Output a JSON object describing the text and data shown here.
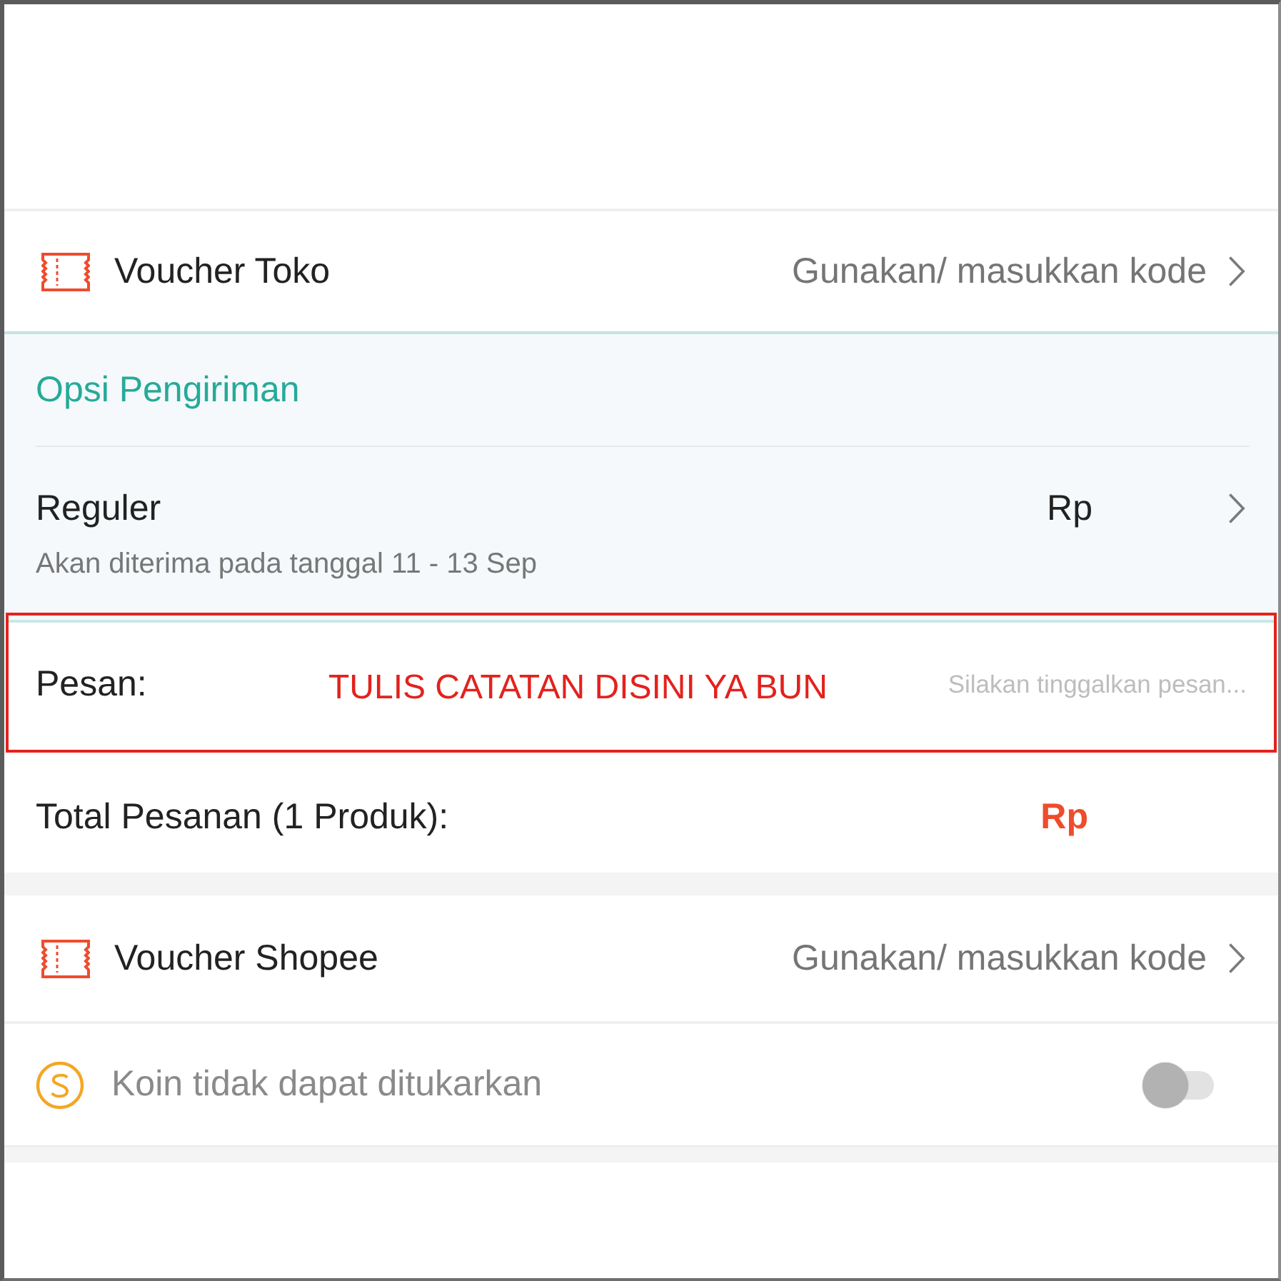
{
  "shop_voucher": {
    "label": "Voucher Toko",
    "action": "Gunakan/ masukkan kode"
  },
  "shipping": {
    "title": "Opsi Pengiriman",
    "option": {
      "name": "Reguler",
      "price": "Rp",
      "estimate": "Akan diterima pada tanggal 11 - 13 Sep"
    }
  },
  "message": {
    "label": "Pesan:",
    "placeholder": "Silakan tinggalkan pesan..."
  },
  "annotation": {
    "text": "TULIS CATATAN DISINI YA BUN"
  },
  "order_total": {
    "label": "Total Pesanan (1 Produk):",
    "amount": "Rp"
  },
  "platform_voucher": {
    "label": "Voucher Shopee",
    "action": "Gunakan/ masukkan kode"
  },
  "coins": {
    "label": "Koin tidak dapat ditukarkan",
    "disabled": true,
    "on": false
  }
}
